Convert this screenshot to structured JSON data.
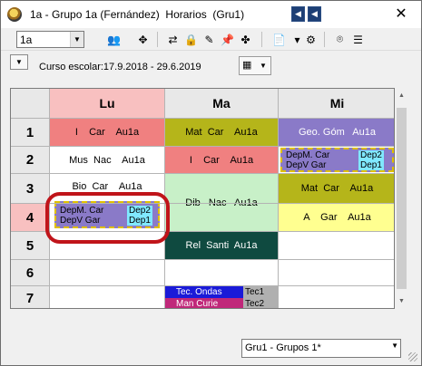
{
  "window": {
    "title": "1a - Grupo 1a (Fernández)  Horarios  (Gru1)",
    "close_glyph": "✕"
  },
  "toolbar": {
    "class_value": "1a"
  },
  "info": {
    "course_label": "Curso escolar:17.9.2018 - 29.6.2019"
  },
  "timetable": {
    "days": [
      {
        "label": "Lu",
        "color": "#f8c0c0"
      },
      {
        "label": "Ma",
        "color": "#e8e8e8"
      },
      {
        "label": "Mi",
        "color": "#e8e8e8"
      }
    ],
    "periods": [
      "1",
      "2",
      "3",
      "4",
      "5",
      "6",
      "7"
    ],
    "lessons": {
      "lu1": "I    Car    Au1a",
      "lu2": "Mus  Nac    Au1a",
      "lu3": "Bio  Car    Au1a",
      "lu4": {
        "left_top": "DepM. Car",
        "left_bottom": "DepV Gar",
        "right_top": "Dep2",
        "right_bottom": "Dep1"
      },
      "ma1": "Mat  Car    Au1a",
      "ma2": "I    Car    Au1a",
      "ma34": "Dib   Nac   Au1a",
      "ma5": "Rel  Santi  Au1a",
      "ma7": {
        "left_top": "Tec.  Ondas",
        "left_bottom": "Man   Curie",
        "right_top": "Tec1",
        "right_bottom": "Tec2"
      },
      "mi1": "Geo. Góm   Au1a",
      "mi2": {
        "left_top": "DepM. Car",
        "left_bottom": "DepV Gar",
        "right_top": "Dep2",
        "right_bottom": "Dep1"
      },
      "mi3": "Mat  Car    Au1a",
      "mi4": "A    Gar    Au1a"
    }
  },
  "footer": {
    "group_select": "Gru1 - Grupos 1*"
  },
  "colors": {
    "accent_highlight": "#c0141a",
    "olive": "#b5b51a",
    "pink": "#f08080",
    "green_light": "#c8f0c8",
    "dark_teal": "#0f4a40",
    "purple": "#8a7ac8",
    "yellow": "#ffff90",
    "blue": "#1a1ad8"
  }
}
